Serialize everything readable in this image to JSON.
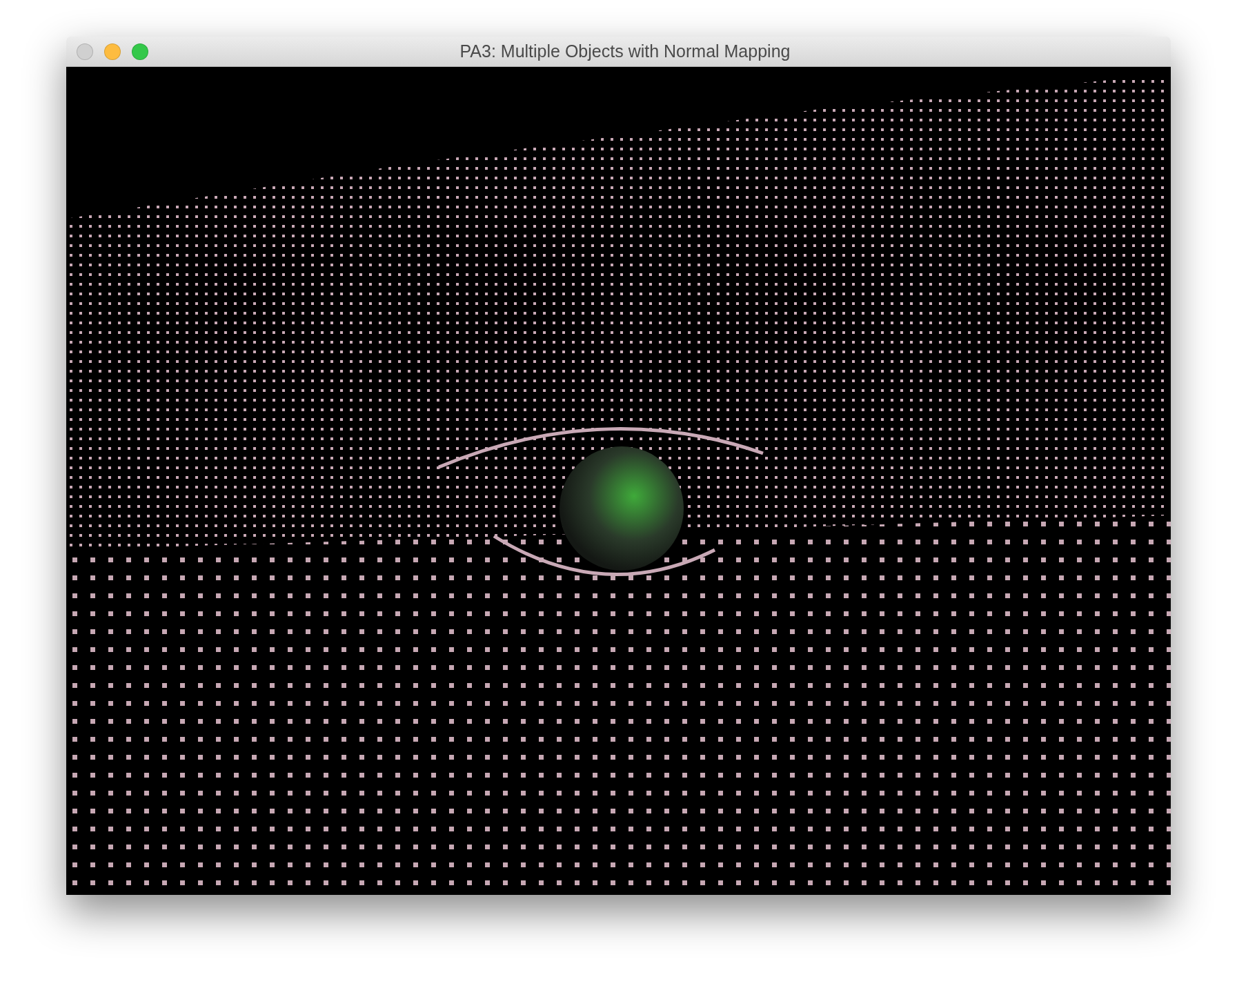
{
  "window": {
    "title": "PA3: Multiple Objects with Normal Mapping",
    "controls": [
      {
        "kind": "close",
        "disabled": true
      },
      {
        "kind": "minimize",
        "disabled": false
      },
      {
        "kind": "zoom",
        "disabled": false
      }
    ]
  }
}
